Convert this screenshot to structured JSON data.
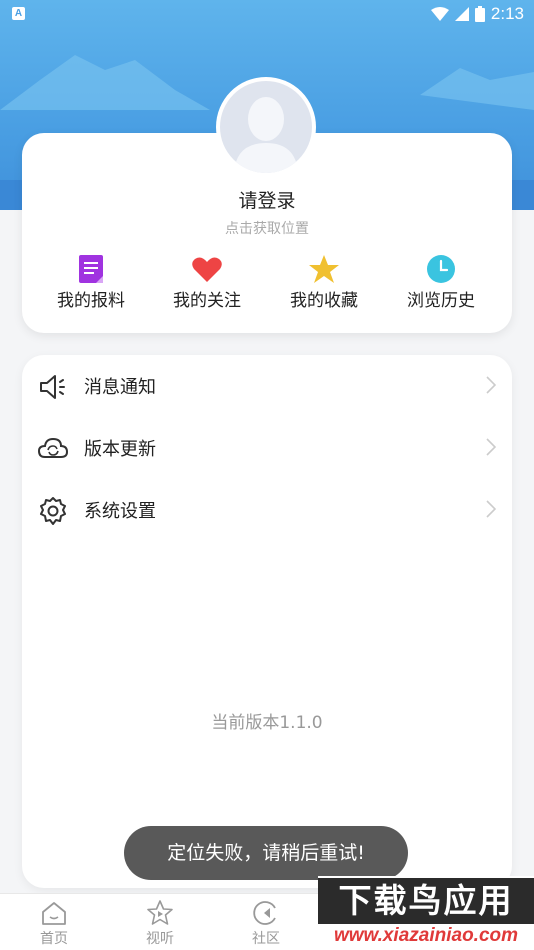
{
  "status_bar": {
    "time": "2:13",
    "notification_icon": "a-icon",
    "wifi_icon": "wifi-icon",
    "signal_icon": "signal-icon",
    "battery_icon": "battery-icon"
  },
  "profile": {
    "login_prompt": "请登录",
    "location_prompt": "点击获取位置",
    "avatar_icon": "avatar-placeholder-icon"
  },
  "quick_actions": [
    {
      "label": "我的报料",
      "icon": "document-icon",
      "color": "#a033e0"
    },
    {
      "label": "我的关注",
      "icon": "heart-icon",
      "color": "#ee4444"
    },
    {
      "label": "我的收藏",
      "icon": "star-icon",
      "color": "#f0c030"
    },
    {
      "label": "浏览历史",
      "icon": "clock-icon",
      "color": "#3ac4e0"
    }
  ],
  "menu": [
    {
      "label": "消息通知",
      "icon": "speaker-icon"
    },
    {
      "label": "版本更新",
      "icon": "cloud-sync-icon"
    },
    {
      "label": "系统设置",
      "icon": "gear-icon"
    }
  ],
  "version_text": "当前版本1.1.0",
  "toast": "定位失败，请稍后重试!",
  "tabs": [
    {
      "label": "首页",
      "icon": "home-icon"
    },
    {
      "label": "视听",
      "icon": "play-star-icon"
    },
    {
      "label": "社区",
      "icon": "community-icon"
    }
  ],
  "watermark": {
    "main": "下载鸟应用",
    "sub": "www.xiazainiao.com"
  },
  "colors": {
    "header_blue": "#4a9fe3",
    "inactive_tab": "#999999"
  }
}
